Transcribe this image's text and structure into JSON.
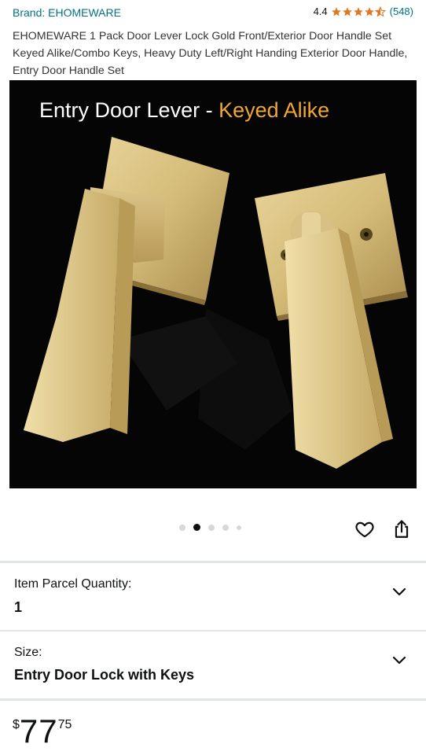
{
  "brand": {
    "label": "Brand: EHOMEWARE"
  },
  "rating": {
    "value": "4.4",
    "stars": 4.4,
    "count": "(548)"
  },
  "title": "EHOMEWARE 1 Pack Door Lever Lock Gold Front/Exterior Door Handle Set Keyed Alike/Combo Keys, Heavy Duty Left/Right Handing Exterior Door Handle, Entry Door Handle Set",
  "image": {
    "caption_main": "Entry Door Lever - ",
    "caption_accent": "Keyed Alike",
    "accent_color": "#f0a830",
    "background_color": "#000000"
  },
  "carousel": {
    "total": 5,
    "active_index": 1
  },
  "actions": {
    "wishlist_icon": "heart-icon",
    "share_icon": "share-icon"
  },
  "quantity": {
    "label": "Item Parcel Quantity:",
    "value": "1"
  },
  "size": {
    "label": "Size:",
    "value": "Entry Door Lock with Keys"
  },
  "price": {
    "symbol": "$",
    "whole": "77",
    "fraction": "75"
  },
  "colors": {
    "link": "#007185",
    "star": "#de7921",
    "divider": "#e3e6e6"
  }
}
